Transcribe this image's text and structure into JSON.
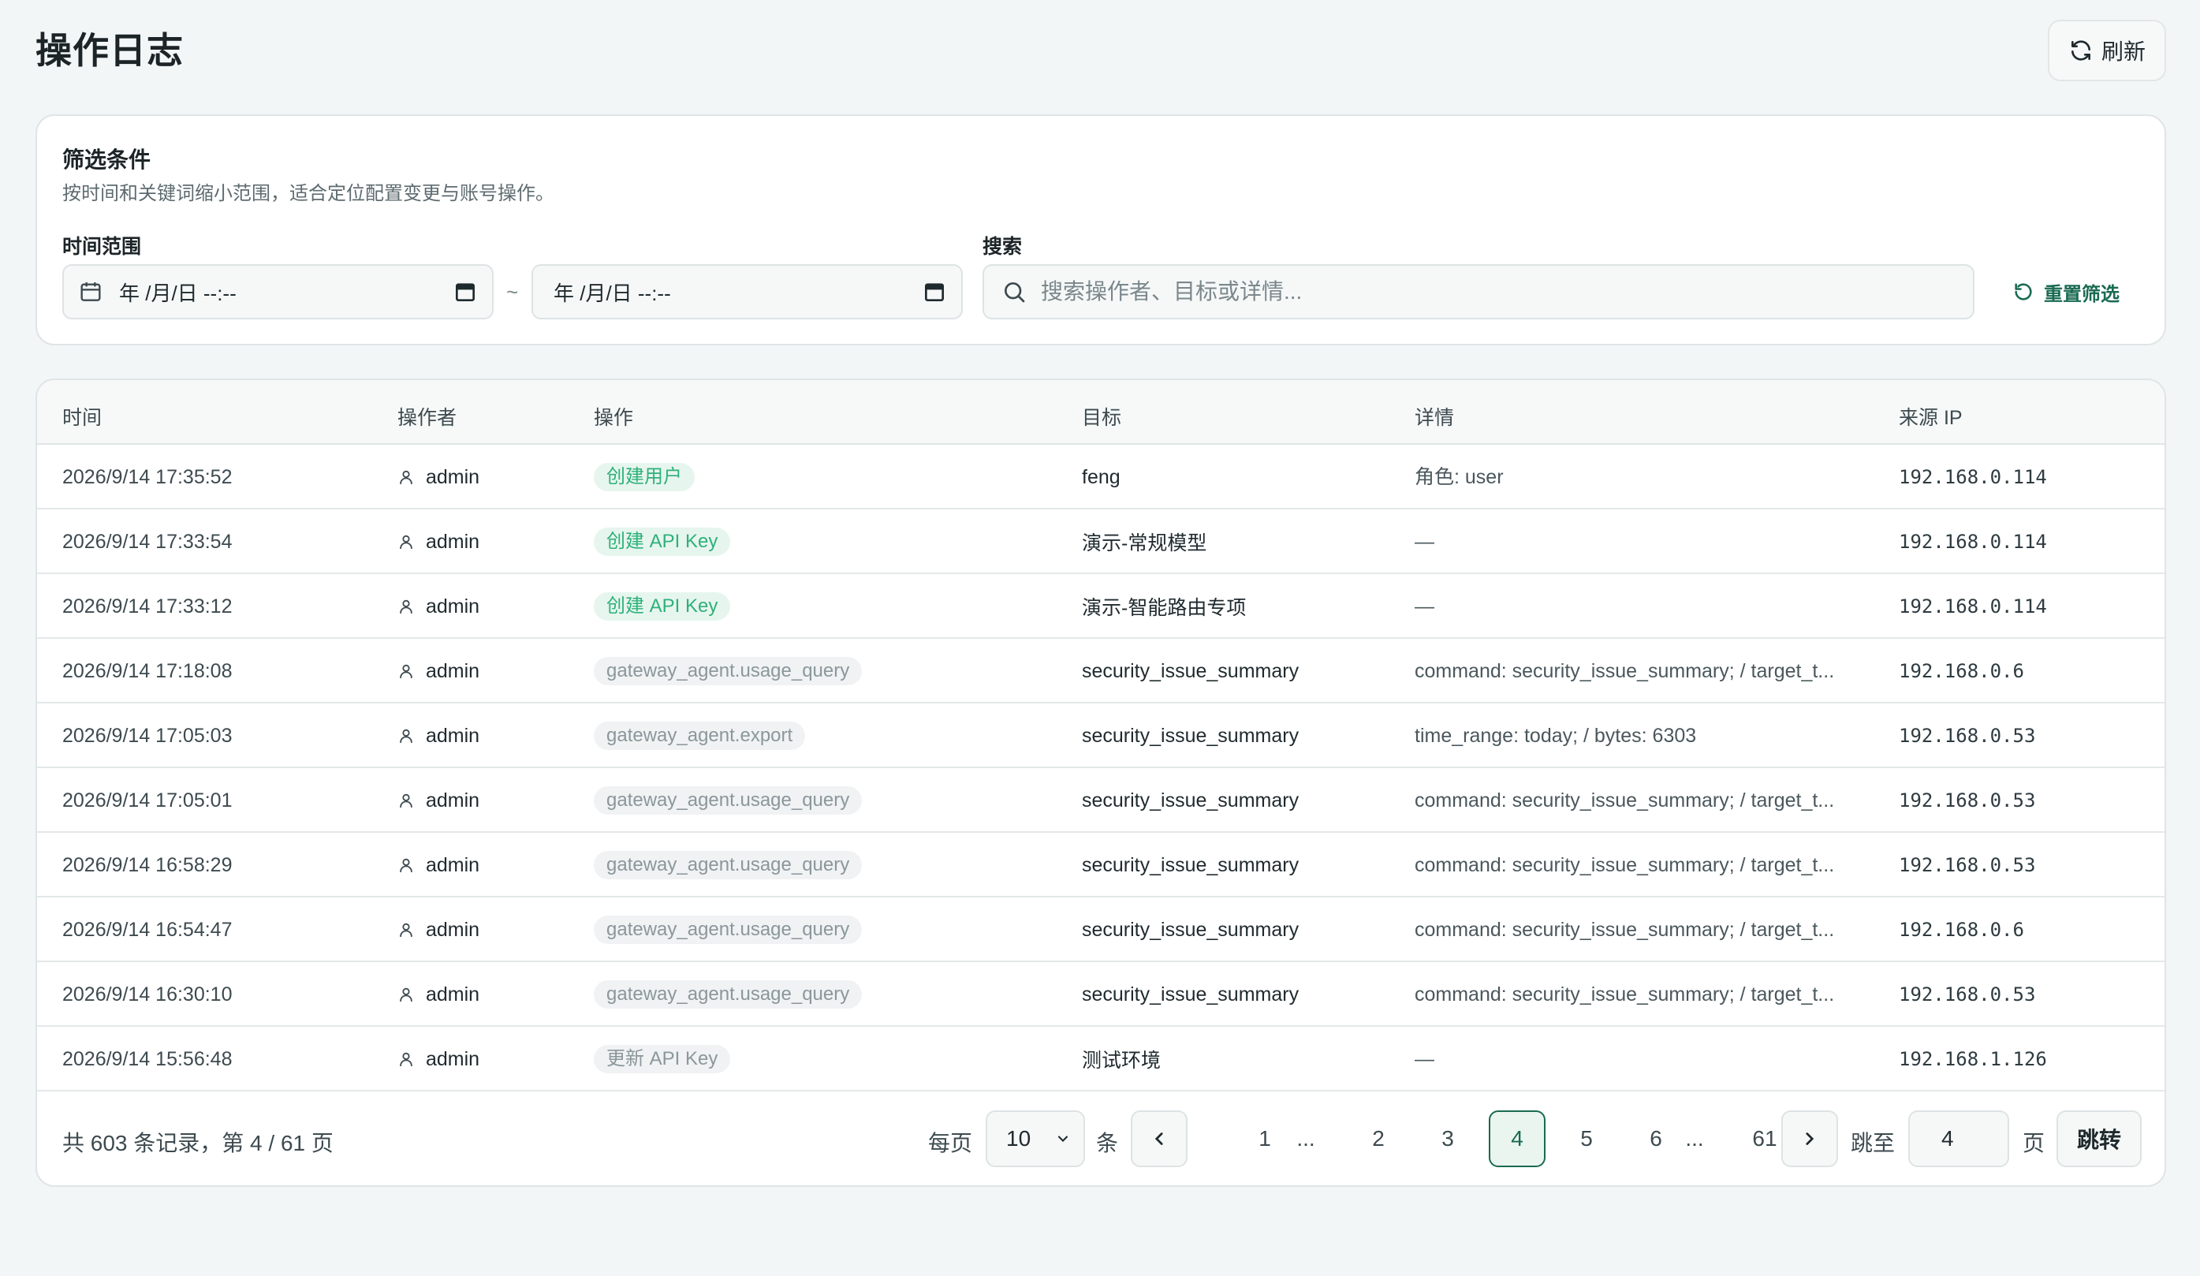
{
  "header": {
    "title": "操作日志",
    "refresh_label": "刷新"
  },
  "filters": {
    "title": "筛选条件",
    "subtitle": "按时间和关键词缩小范围，适合定位配置变更与账号操作。",
    "time_label": "时间范围",
    "start_value": "年 /月/日 --:--",
    "separator": "~",
    "end_value": "年 /月/日 --:--",
    "search_label": "搜索",
    "search_placeholder": "搜索操作者、目标或详情...",
    "reset_label": "重置筛选"
  },
  "table": {
    "columns": [
      "时间",
      "操作者",
      "操作",
      "目标",
      "详情",
      "来源 IP"
    ],
    "rows": [
      {
        "time": "2026/9/14 17:35:52",
        "operator": "admin",
        "action": "创建用户",
        "action_style": "green",
        "target": "feng",
        "detail": "角色: user",
        "ip": "192.168.0.114"
      },
      {
        "time": "2026/9/14 17:33:54",
        "operator": "admin",
        "action": "创建 API Key",
        "action_style": "green",
        "target": "演示-常规模型",
        "detail": "—",
        "ip": "192.168.0.114"
      },
      {
        "time": "2026/9/14 17:33:12",
        "operator": "admin",
        "action": "创建 API Key",
        "action_style": "green",
        "target": "演示-智能路由专项",
        "detail": "—",
        "ip": "192.168.0.114"
      },
      {
        "time": "2026/9/14 17:18:08",
        "operator": "admin",
        "action": "gateway_agent.usage_query",
        "action_style": "gray",
        "target": "security_issue_summary",
        "detail": "command: security_issue_summary; / target_t...",
        "ip": "192.168.0.6"
      },
      {
        "time": "2026/9/14 17:05:03",
        "operator": "admin",
        "action": "gateway_agent.export",
        "action_style": "gray",
        "target": "security_issue_summary",
        "detail": "time_range: today; / bytes: 6303",
        "ip": "192.168.0.53"
      },
      {
        "time": "2026/9/14 17:05:01",
        "operator": "admin",
        "action": "gateway_agent.usage_query",
        "action_style": "gray",
        "target": "security_issue_summary",
        "detail": "command: security_issue_summary; / target_t...",
        "ip": "192.168.0.53"
      },
      {
        "time": "2026/9/14 16:58:29",
        "operator": "admin",
        "action": "gateway_agent.usage_query",
        "action_style": "gray",
        "target": "security_issue_summary",
        "detail": "command: security_issue_summary; / target_t...",
        "ip": "192.168.0.53"
      },
      {
        "time": "2026/9/14 16:54:47",
        "operator": "admin",
        "action": "gateway_agent.usage_query",
        "action_style": "gray",
        "target": "security_issue_summary",
        "detail": "command: security_issue_summary; / target_t...",
        "ip": "192.168.0.6"
      },
      {
        "time": "2026/9/14 16:30:10",
        "operator": "admin",
        "action": "gateway_agent.usage_query",
        "action_style": "gray",
        "target": "security_issue_summary",
        "detail": "command: security_issue_summary; / target_t...",
        "ip": "192.168.0.53"
      },
      {
        "time": "2026/9/14 15:56:48",
        "operator": "admin",
        "action": "更新 API Key",
        "action_style": "gray",
        "target": "测试环境",
        "detail": "—",
        "ip": "192.168.1.126"
      }
    ]
  },
  "pagination": {
    "summary": "共 603 条记录，第 4 / 61 页",
    "per_page_label": "每页",
    "per_page_value": "10",
    "per_page_unit": "条",
    "pages": [
      "1",
      "...",
      "2",
      "3",
      "4",
      "5",
      "6",
      "...",
      "61"
    ],
    "current_page": "4",
    "jump_label": "跳至",
    "jump_value": "4",
    "jump_unit": "页",
    "jump_button": "跳转"
  },
  "colors": {
    "accent": "#1a6a52",
    "badge_green_text": "#2fb07a",
    "badge_green_bg": "#e6f6ee",
    "badge_gray_text": "#8b979b",
    "badge_gray_bg": "#f0f2f3",
    "page_bg": "#f3f6f7"
  }
}
